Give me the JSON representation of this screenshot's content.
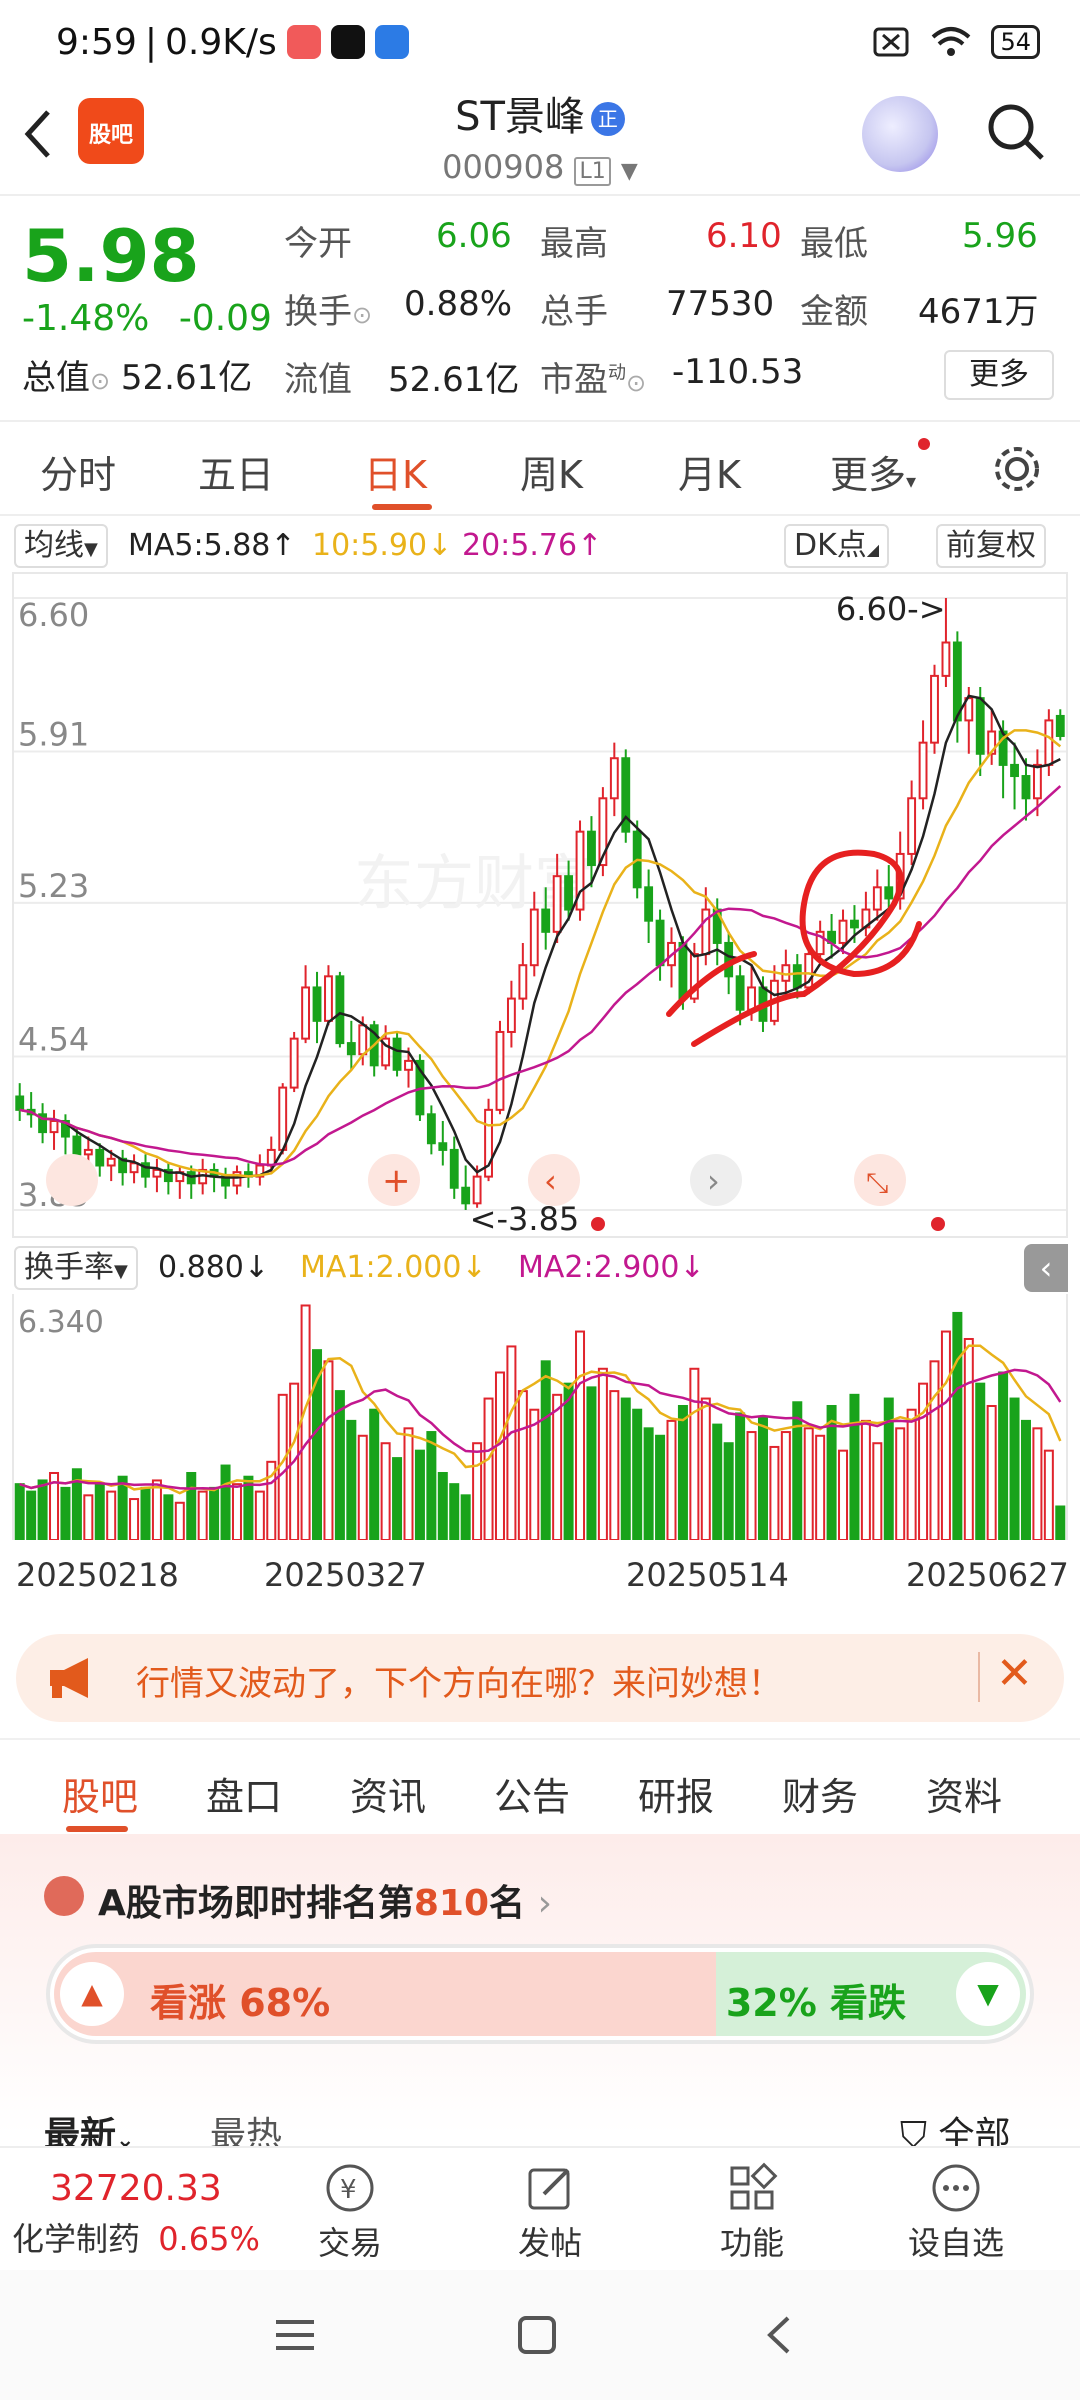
{
  "status": {
    "time": "9:59",
    "net_speed": "0.9K/s",
    "battery": "54"
  },
  "header": {
    "logo_text": "股吧",
    "stock_name": "ST景峰",
    "verify_mark": "正",
    "stock_code": "000908",
    "level": "L1"
  },
  "quote": {
    "price": "5.98",
    "change_pct": "-1.48%",
    "change": "-0.09",
    "open_label": "今开",
    "open": "6.06",
    "high_label": "最高",
    "high": "6.10",
    "low_label": "最低",
    "low": "5.96",
    "turnover_label": "换手",
    "turnover": "0.88%",
    "volume_label": "总手",
    "volume": "77530",
    "amount_label": "金额",
    "amount": "4671万",
    "mktcap_label": "总值",
    "mktcap": "52.61亿",
    "float_label": "流值",
    "float": "52.61亿",
    "pe_label": "市盈",
    "pe_sup": "动",
    "pe": "-110.53",
    "more": "更多"
  },
  "period_tabs": [
    "分时",
    "五日",
    "日K",
    "周K",
    "月K",
    "更多"
  ],
  "ma_bar": {
    "selector": "均线",
    "ma5": "MA5:5.88↑",
    "ma10": "10:5.90↓",
    "ma20": "20:5.76↑",
    "dk": "DK点",
    "adjust": "前复权"
  },
  "vol_bar": {
    "selector": "换手率",
    "value": "0.880↓",
    "ma1": "MA1:2.000↓",
    "ma2": "MA2:2.900↓"
  },
  "chart_data": {
    "type": "candlestick",
    "y_ticks": [
      "6.60",
      "5.91",
      "5.23",
      "4.54",
      "3.85"
    ],
    "ylim": [
      3.85,
      6.6
    ],
    "max_label": "6.60->",
    "min_label": "<-3.85",
    "x_labels": [
      "20250218",
      "20250327",
      "20250514",
      "20250627"
    ],
    "candles": [
      [
        4.36,
        4.3,
        4.42,
        4.25
      ],
      [
        4.3,
        4.28,
        4.38,
        4.22
      ],
      [
        4.28,
        4.2,
        4.33,
        4.15
      ],
      [
        4.2,
        4.25,
        4.3,
        4.12
      ],
      [
        4.25,
        4.18,
        4.28,
        4.1
      ],
      [
        4.18,
        4.1,
        4.22,
        4.05
      ],
      [
        4.1,
        4.12,
        4.18,
        4.02
      ],
      [
        4.12,
        4.05,
        4.15,
        4.0
      ],
      [
        4.05,
        4.08,
        4.12,
        3.98
      ],
      [
        4.08,
        4.02,
        4.12,
        3.96
      ],
      [
        4.02,
        4.06,
        4.1,
        3.97
      ],
      [
        4.06,
        4.0,
        4.1,
        3.95
      ],
      [
        4.0,
        4.03,
        4.08,
        3.93
      ],
      [
        4.03,
        3.98,
        4.06,
        3.92
      ],
      [
        3.98,
        4.02,
        4.05,
        3.9
      ],
      [
        4.02,
        3.97,
        4.05,
        3.9
      ],
      [
        3.97,
        4.03,
        4.08,
        3.92
      ],
      [
        4.03,
        4.0,
        4.06,
        3.93
      ],
      [
        4.0,
        3.96,
        4.04,
        3.9
      ],
      [
        3.96,
        4.02,
        4.05,
        3.92
      ],
      [
        4.02,
        4.0,
        4.06,
        3.95
      ],
      [
        4.0,
        4.05,
        4.1,
        3.96
      ],
      [
        4.05,
        4.12,
        4.18,
        4.02
      ],
      [
        4.12,
        4.4,
        4.42,
        4.1
      ],
      [
        4.4,
        4.62,
        4.65,
        4.38
      ],
      [
        4.62,
        4.85,
        4.95,
        4.6
      ],
      [
        4.85,
        4.7,
        4.92,
        4.6
      ],
      [
        4.7,
        4.9,
        4.95,
        4.68
      ],
      [
        4.9,
        4.6,
        4.92,
        4.58
      ],
      [
        4.6,
        4.55,
        4.7,
        4.48
      ],
      [
        4.55,
        4.68,
        4.72,
        4.5
      ],
      [
        4.68,
        4.5,
        4.7,
        4.45
      ],
      [
        4.5,
        4.62,
        4.68,
        4.48
      ],
      [
        4.62,
        4.48,
        4.65,
        4.45
      ],
      [
        4.48,
        4.52,
        4.58,
        4.4
      ],
      [
        4.52,
        4.28,
        4.55,
        4.25
      ],
      [
        4.28,
        4.15,
        4.32,
        4.1
      ],
      [
        4.15,
        4.12,
        4.25,
        4.05
      ],
      [
        4.12,
        3.95,
        4.18,
        3.9
      ],
      [
        3.95,
        3.88,
        4.05,
        3.85
      ],
      [
        3.88,
        4.0,
        4.05,
        3.86
      ],
      [
        4.0,
        4.3,
        4.35,
        3.98
      ],
      [
        4.3,
        4.65,
        4.7,
        4.28
      ],
      [
        4.65,
        4.8,
        4.88,
        4.58
      ],
      [
        4.8,
        4.95,
        5.05,
        4.75
      ],
      [
        4.95,
        5.2,
        5.28,
        4.9
      ],
      [
        5.2,
        5.1,
        5.3,
        5.02
      ],
      [
        5.1,
        5.35,
        5.45,
        5.05
      ],
      [
        5.35,
        5.2,
        5.42,
        5.15
      ],
      [
        5.2,
        5.55,
        5.6,
        5.15
      ],
      [
        5.55,
        5.4,
        5.62,
        5.3
      ],
      [
        5.4,
        5.7,
        5.75,
        5.35
      ],
      [
        5.7,
        5.88,
        5.95,
        5.62
      ],
      [
        5.88,
        5.55,
        5.92,
        5.5
      ],
      [
        5.55,
        5.3,
        5.6,
        5.25
      ],
      [
        5.3,
        5.15,
        5.38,
        5.05
      ],
      [
        5.15,
        4.95,
        5.2,
        4.88
      ],
      [
        4.95,
        5.05,
        5.12,
        4.85
      ],
      [
        5.05,
        4.8,
        5.08,
        4.75
      ],
      [
        4.8,
        5.0,
        5.05,
        4.78
      ],
      [
        5.0,
        5.2,
        5.3,
        4.95
      ],
      [
        5.2,
        5.05,
        5.25,
        4.95
      ],
      [
        5.05,
        4.9,
        5.1,
        4.82
      ],
      [
        4.9,
        4.75,
        4.95,
        4.68
      ],
      [
        4.75,
        4.85,
        4.95,
        4.7
      ],
      [
        4.85,
        4.7,
        4.9,
        4.65
      ],
      [
        4.7,
        4.88,
        4.95,
        4.68
      ],
      [
        4.88,
        4.95,
        5.02,
        4.8
      ],
      [
        4.95,
        4.85,
        5.0,
        4.8
      ],
      [
        4.85,
        5.0,
        5.05,
        4.82
      ],
      [
        5.0,
        5.1,
        5.15,
        4.95
      ],
      [
        5.1,
        5.05,
        5.18,
        4.98
      ],
      [
        5.05,
        5.15,
        5.2,
        5.0
      ],
      [
        5.15,
        5.12,
        5.22,
        5.05
      ],
      [
        5.12,
        5.2,
        5.28,
        5.08
      ],
      [
        5.2,
        5.3,
        5.38,
        5.15
      ],
      [
        5.3,
        5.25,
        5.4,
        5.2
      ],
      [
        5.25,
        5.45,
        5.55,
        5.2
      ],
      [
        5.45,
        5.7,
        5.78,
        5.4
      ],
      [
        5.7,
        5.95,
        6.05,
        5.65
      ],
      [
        5.95,
        6.25,
        6.3,
        5.9
      ],
      [
        6.25,
        6.4,
        6.6,
        6.2
      ],
      [
        6.4,
        6.05,
        6.45,
        5.95
      ],
      [
        6.05,
        6.15,
        6.2,
        5.9
      ],
      [
        6.15,
        5.9,
        6.2,
        5.8
      ],
      [
        5.9,
        6.0,
        6.1,
        5.85
      ],
      [
        6.0,
        5.85,
        6.05,
        5.7
      ],
      [
        5.85,
        5.8,
        5.95,
        5.65
      ],
      [
        5.8,
        5.7,
        5.88,
        5.6
      ],
      [
        5.7,
        5.85,
        5.92,
        5.62
      ],
      [
        5.85,
        6.05,
        6.1,
        5.8
      ],
      [
        6.07,
        5.98,
        6.1,
        5.96
      ]
    ],
    "turnover_ymax": 6.34,
    "turnover": [
      1.5,
      1.3,
      1.6,
      1.8,
      1.4,
      1.9,
      1.2,
      1.5,
      1.3,
      1.7,
      1.1,
      1.4,
      1.6,
      1.2,
      1.0,
      1.8,
      1.3,
      1.4,
      2.0,
      1.5,
      1.7,
      1.3,
      2.1,
      3.9,
      4.2,
      6.3,
      5.1,
      4.8,
      4.0,
      3.2,
      2.8,
      3.5,
      2.6,
      2.2,
      3.0,
      2.4,
      2.9,
      1.8,
      1.5,
      1.2,
      2.6,
      3.8,
      4.5,
      5.2,
      4.0,
      3.5,
      4.8,
      3.9,
      4.2,
      5.6,
      4.1,
      4.6,
      4.0,
      3.8,
      3.5,
      3.0,
      2.8,
      3.2,
      3.6,
      4.6,
      3.8,
      3.1,
      2.6,
      3.4,
      2.9,
      3.3,
      2.5,
      2.9,
      3.7,
      3.0,
      2.8,
      3.6,
      2.4,
      3.9,
      3.2,
      2.6,
      3.8,
      3.0,
      3.5,
      4.2,
      4.8,
      5.6,
      6.1,
      5.4,
      4.2,
      3.6,
      4.5,
      3.8,
      3.2,
      3.0,
      2.4,
      0.9
    ]
  },
  "banner": {
    "text": "行情又波动了，下个方向在哪？来问妙想！"
  },
  "section_tabs": [
    "股吧",
    "盘口",
    "资讯",
    "公告",
    "研报",
    "财务",
    "资料"
  ],
  "rank": {
    "prefix": "A股市场即时排名第",
    "num": "810",
    "suffix": "名",
    "bull": "看涨 68%",
    "bear": "32% 看跌",
    "bull_fraction": 0.68
  },
  "feed": {
    "latest": "最新",
    "hot": "最热",
    "all": "全部"
  },
  "bottom": {
    "index_value": "32720.33",
    "index_name": "化学制药",
    "index_chg": "0.65%",
    "items": [
      "交易",
      "发帖",
      "功能",
      "设自选"
    ]
  },
  "colors": {
    "up": "#e0242c",
    "down": "#19a31b",
    "accent": "#e0502a",
    "ma5": "#222222",
    "ma10": "#e9b21a",
    "ma20": "#c2188f"
  }
}
